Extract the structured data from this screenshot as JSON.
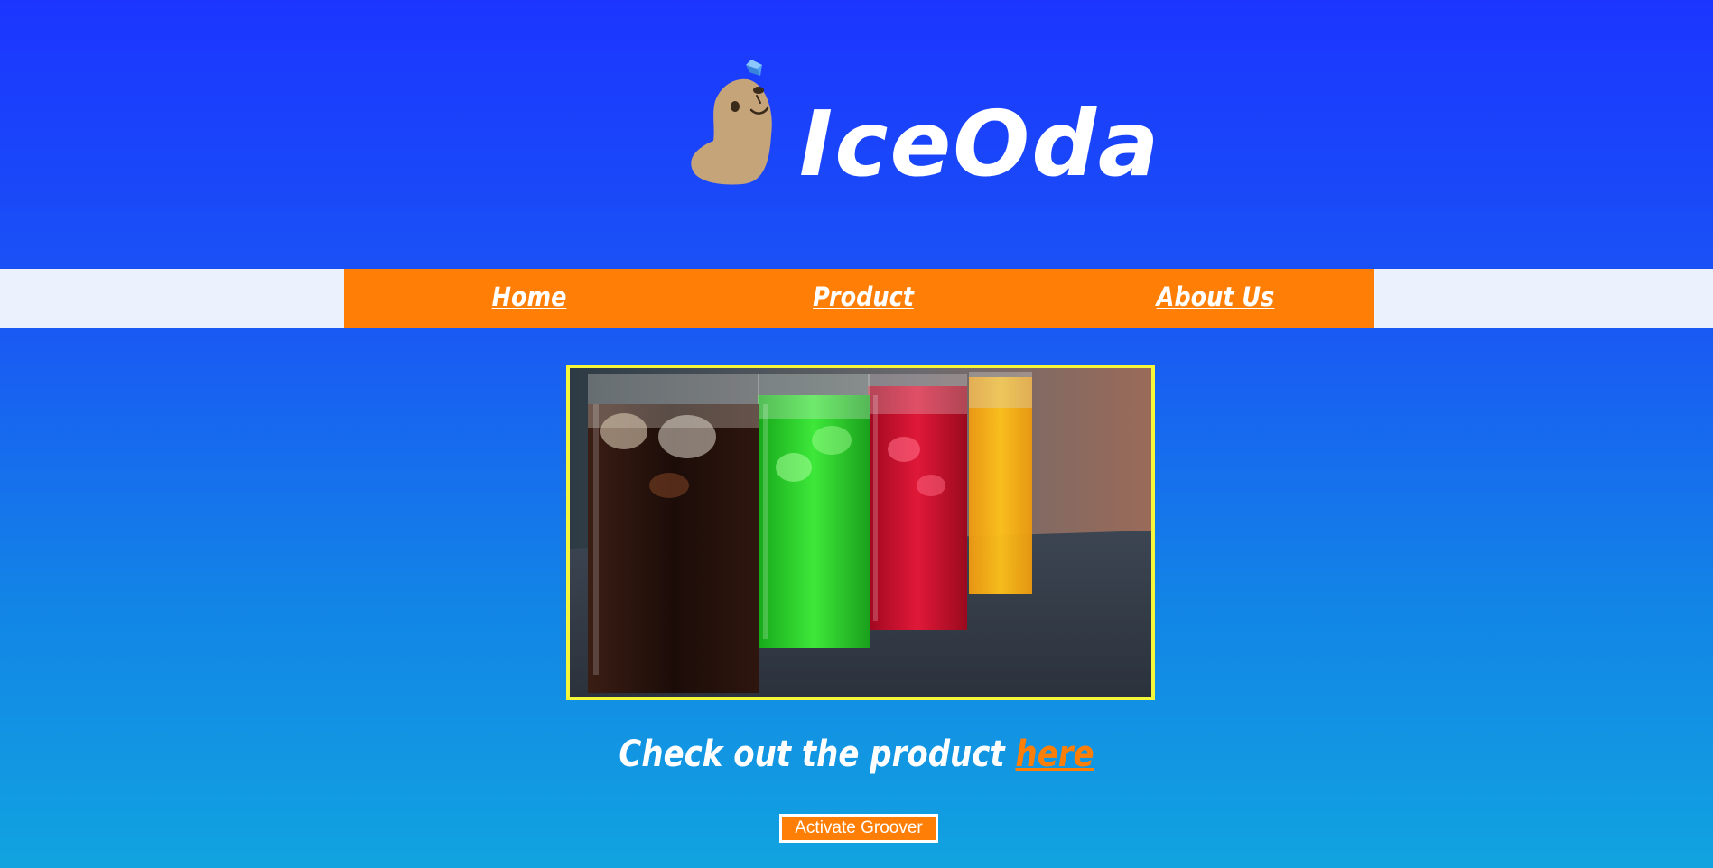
{
  "brand": {
    "name": "IceOda",
    "logo_text": "IceOda"
  },
  "nav": {
    "items": [
      {
        "label": "Home"
      },
      {
        "label": "Product"
      },
      {
        "label": "About Us"
      }
    ]
  },
  "hero": {
    "image": "colorful-soda-glasses-photo"
  },
  "cta": {
    "text": "Check out the product",
    "link_label": "here"
  },
  "button": {
    "label": "Activate Groover"
  },
  "colors": {
    "accent": "#ff7f06",
    "frame": "#f4f73a",
    "background_top": "#1b35ff",
    "background_bottom": "#11a3e0",
    "nav_band": "#ebf1fd"
  }
}
